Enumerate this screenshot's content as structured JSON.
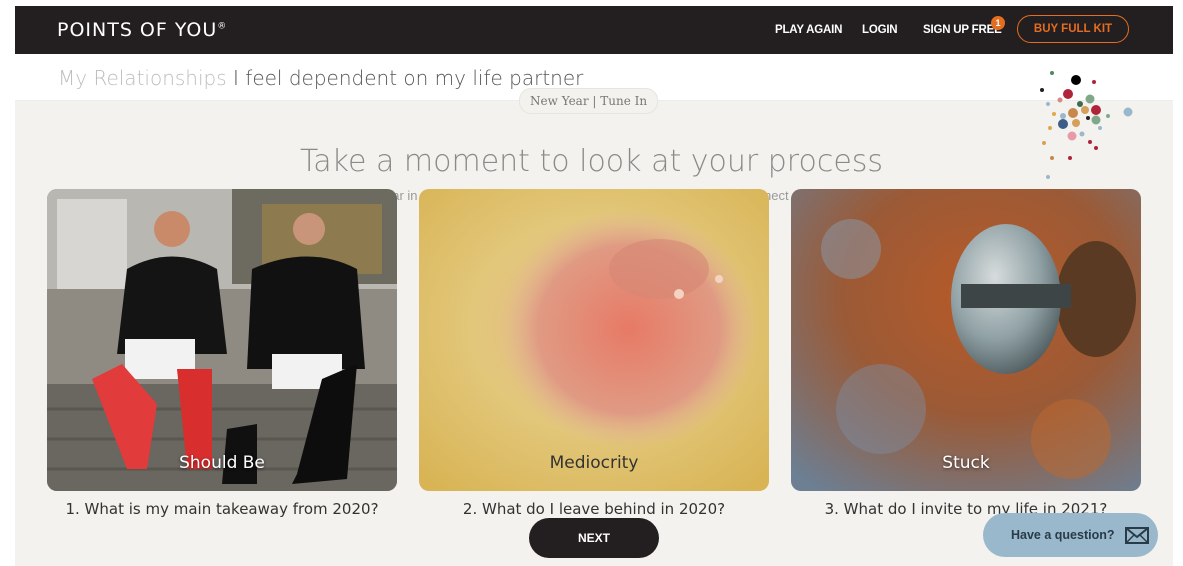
{
  "header": {
    "logo": "POINTS OF YOU",
    "logo_mark": "®",
    "nav": {
      "play_again": "PLAY AGAIN",
      "login": "LOGIN",
      "signup": "SIGN UP FREE",
      "signup_badge": "1",
      "buy_kit": "BUY FULL KIT"
    }
  },
  "breadcrumb": {
    "category": "My Relationships",
    "topic": "I feel dependent on my life partner"
  },
  "session_pill": "New Year | Tune In",
  "main": {
    "heading": "Take a moment to look at your process",
    "subtext_left": "ear in",
    "subtext_right": "nect"
  },
  "cards": [
    {
      "label": "Should Be",
      "question": "1. What is my main takeaway from 2020?"
    },
    {
      "label": "Mediocrity",
      "question": "2. What do I leave behind in 2020?"
    },
    {
      "label": "Stuck",
      "question": "3. What do I invite to my life in 2021?"
    }
  ],
  "next_label": "NEXT",
  "help_label": "Have a question?",
  "icons": {
    "help": "envelope-icon"
  },
  "colors": {
    "brand_dark": "#231f20",
    "accent": "#e56d1f",
    "help_bg": "#9ab8cc",
    "bg": "#f4f2ee"
  }
}
